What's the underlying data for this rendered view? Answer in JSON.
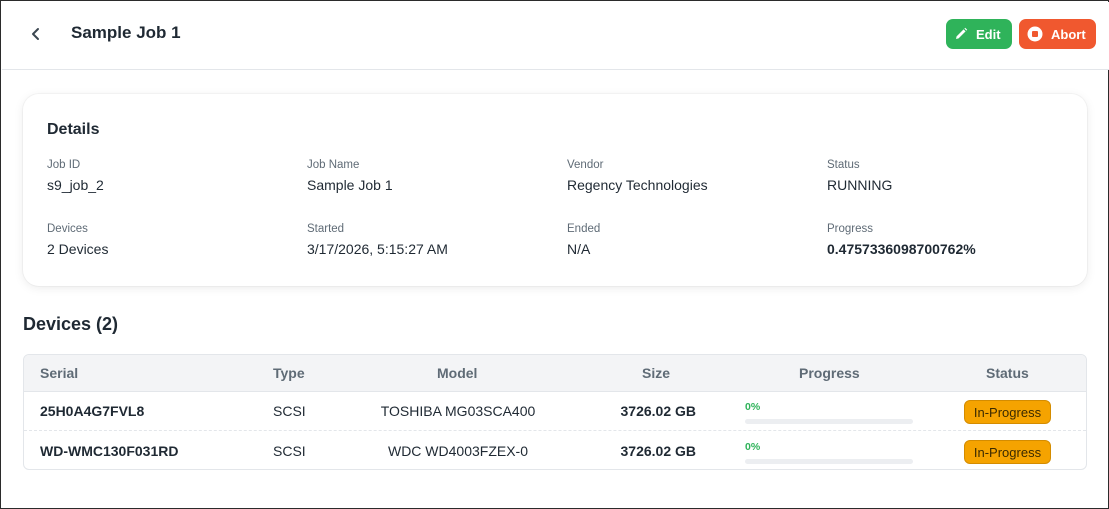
{
  "header": {
    "title": "Sample Job 1",
    "edit_label": "Edit",
    "abort_label": "Abort"
  },
  "details": {
    "title": "Details",
    "fields": [
      {
        "label": "Job ID",
        "value": "s9_job_2"
      },
      {
        "label": "Job Name",
        "value": "Sample Job 1"
      },
      {
        "label": "Vendor",
        "value": "Regency Technologies"
      },
      {
        "label": "Status",
        "value": "RUNNING"
      },
      {
        "label": "Devices",
        "value": "2 Devices"
      },
      {
        "label": "Started",
        "value": "3/17/2026, 5:15:27 AM"
      },
      {
        "label": "Ended",
        "value": "N/A"
      },
      {
        "label": "Progress",
        "value": "0.4757336098700762%"
      }
    ]
  },
  "devices": {
    "title": "Devices (2)",
    "columns": [
      "Serial",
      "Type",
      "Model",
      "Size",
      "Progress",
      "Status"
    ],
    "rows": [
      {
        "serial": "25H0A4G7FVL8",
        "type": "SCSI",
        "model": "TOSHIBA MG03SCA400",
        "size": "3726.02 GB",
        "progress_label": "0%",
        "progress": 0,
        "status": "In-Progress"
      },
      {
        "serial": "WD-WMC130F031RD",
        "type": "SCSI",
        "model": "WDC WD4003FZEX-0",
        "size": "3726.02 GB",
        "progress_label": "0%",
        "progress": 0,
        "status": "In-Progress"
      }
    ]
  },
  "colors": {
    "edit": "#2fb35a",
    "abort": "#f0582f",
    "status_badge": "#f5a300",
    "progress": "#2fb35a"
  },
  "icons": {
    "back": "chevron-left-icon",
    "edit": "pencil-icon",
    "abort": "stop-circle-icon"
  }
}
